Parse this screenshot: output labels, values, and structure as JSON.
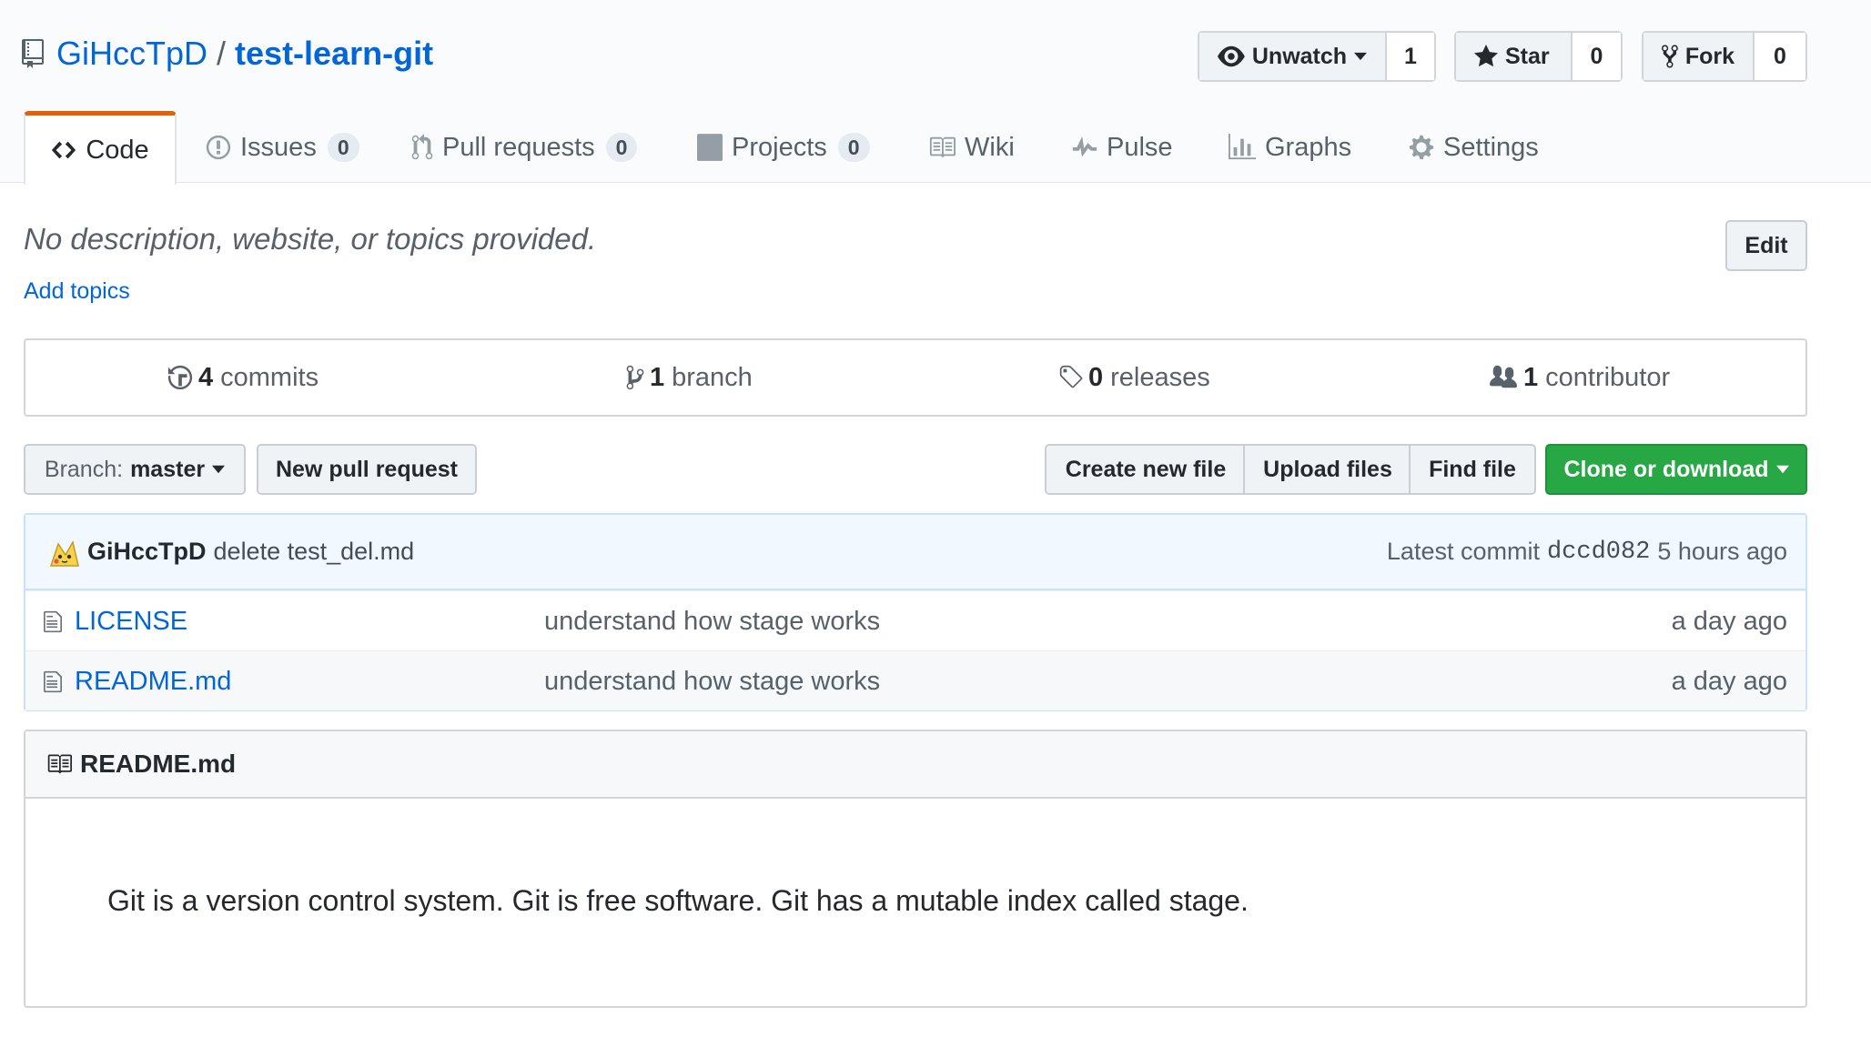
{
  "repo": {
    "owner": "GiHccTpD",
    "separator": "/",
    "name": "test-learn-git"
  },
  "actions": {
    "watch": {
      "label": "Unwatch",
      "count": "1"
    },
    "star": {
      "label": "Star",
      "count": "0"
    },
    "fork": {
      "label": "Fork",
      "count": "0"
    }
  },
  "tabs": [
    {
      "label": "Code",
      "icon": "code-icon",
      "selected": true
    },
    {
      "label": "Issues",
      "count": "0",
      "icon": "issue-icon"
    },
    {
      "label": "Pull requests",
      "count": "0",
      "icon": "pull-request-icon"
    },
    {
      "label": "Projects",
      "count": "0",
      "icon": "project-icon"
    },
    {
      "label": "Wiki",
      "icon": "book-icon"
    },
    {
      "label": "Pulse",
      "icon": "pulse-icon"
    },
    {
      "label": "Graphs",
      "icon": "graph-icon"
    },
    {
      "label": "Settings",
      "icon": "gear-icon"
    }
  ],
  "description": "No description, website, or topics provided.",
  "add_topics": "Add topics",
  "edit_label": "Edit",
  "summary": {
    "commits": {
      "count": "4",
      "label": "commits"
    },
    "branches": {
      "count": "1",
      "label": "branch"
    },
    "releases": {
      "count": "0",
      "label": "releases"
    },
    "contributors": {
      "count": "1",
      "label": "contributor"
    }
  },
  "file_nav": {
    "branch_prefix": "Branch:",
    "branch": "master",
    "new_pr": "New pull request",
    "create_file": "Create new file",
    "upload": "Upload files",
    "find": "Find file",
    "clone": "Clone or download"
  },
  "latest_commit": {
    "author": "GiHccTpD",
    "message": "delete test_del.md",
    "label": "Latest commit",
    "sha": "dccd082",
    "age": "5 hours ago"
  },
  "files": [
    {
      "name": "LICENSE",
      "message": "understand how stage works",
      "age": "a day ago"
    },
    {
      "name": "README.md",
      "message": "understand how stage works",
      "age": "a day ago"
    }
  ],
  "readme": {
    "title": "README.md",
    "body": "Git is a version control system. Git is free software. Git has a mutable index called stage."
  },
  "colors": {
    "link": "#0366d6",
    "selected_tab": "#e36209",
    "green": "#28a745"
  }
}
